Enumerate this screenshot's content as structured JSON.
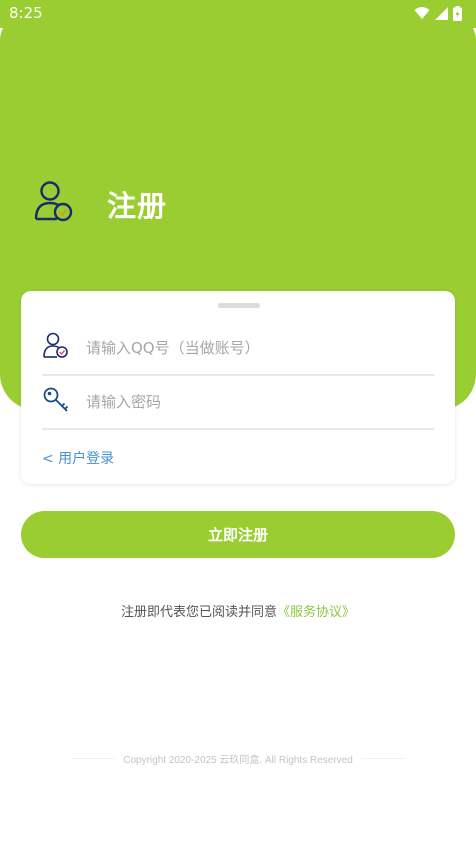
{
  "status_bar": {
    "time": "8:25",
    "icons": [
      "wifi-icon",
      "signal-icon",
      "battery-charging-icon"
    ]
  },
  "header": {
    "title": "注册",
    "icon": "user-verified-icon"
  },
  "form": {
    "qq_field": {
      "placeholder": "请输入QQ号（当做账号）",
      "value": "",
      "icon": "user-check-icon"
    },
    "password_field": {
      "placeholder": "请输入密码",
      "value": "",
      "icon": "key-icon"
    },
    "login_link": "< 用户登录"
  },
  "register_button": "立即注册",
  "agreement": {
    "prefix": "注册即代表您已阅读并同意",
    "link": "《服务协议》"
  },
  "footer": {
    "copyright": "Copyright 2020-2025 云玖同盒. All Rights Reserved"
  },
  "colors": {
    "brand": "#9acd32",
    "link": "#4a90d9",
    "agreement_link": "#8dc63f"
  }
}
